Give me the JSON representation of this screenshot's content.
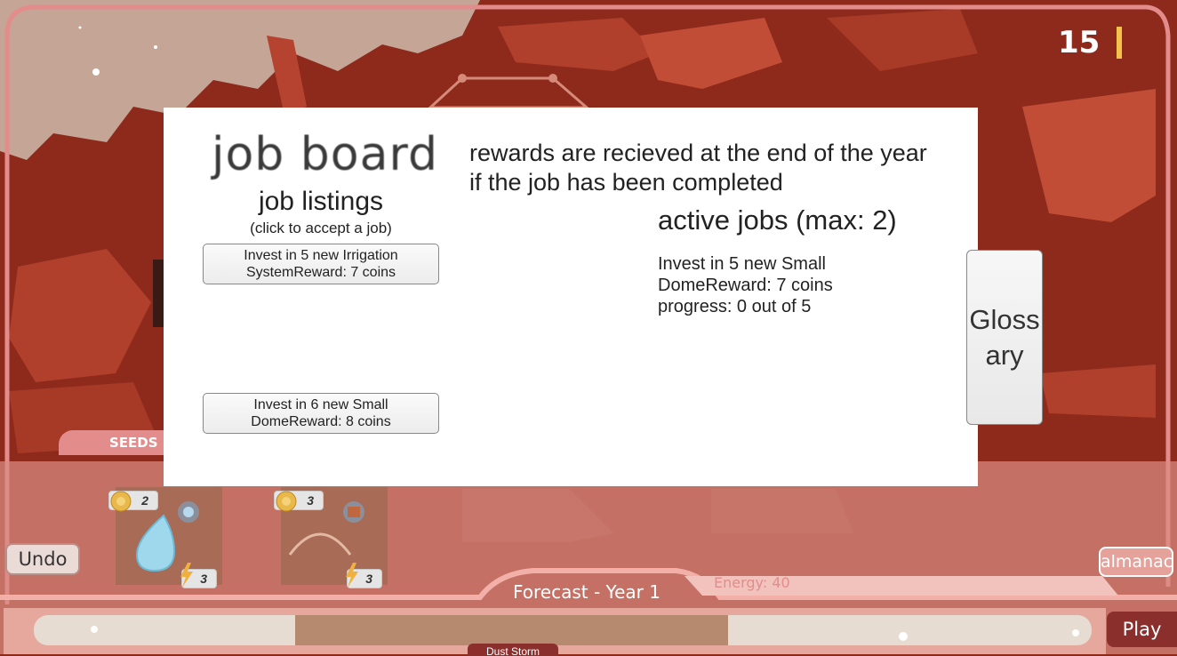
{
  "hud": {
    "counter": "15",
    "seeds_label": "SEEDS",
    "undo_label": "Undo",
    "almanac_label": "almanac",
    "forecast_label": "Forecast - Year 1",
    "energy_label": "Energy: 40",
    "play_label": "Play",
    "timeline_event": "Dust Storm"
  },
  "seeds": [
    {
      "name": "water-seed",
      "coin_cost": "2",
      "energy_cost": "3"
    },
    {
      "name": "dome-seed",
      "coin_cost": "3",
      "energy_cost": "3"
    }
  ],
  "job_board": {
    "title": "job board",
    "listings_title": "job listings",
    "listings_hint": "(click to accept a job)",
    "listings": [
      {
        "line1": "Invest in 5 new Irrigation",
        "line2": "SystemReward: 7 coins"
      },
      {
        "line1": "Invest in 6 new Small",
        "line2": "DomeReward: 8 coins"
      }
    ],
    "rewards_note": "rewards are recieved at the end of the year if the job has been completed",
    "active_title": "active jobs (max: 2)",
    "active_jobs": [
      {
        "line1": "Invest in 5 new Small",
        "line2": "DomeReward: 7 coins",
        "line3": "progress: 0 out of 5"
      }
    ],
    "glossary_line1": "Gloss",
    "glossary_line2": "ary"
  },
  "colors": {
    "mars_red": "#8e2a1c",
    "panel_pink": "#e38c8c",
    "play_button": "#8b2f2d",
    "counter_bar": "#f5c24e"
  }
}
